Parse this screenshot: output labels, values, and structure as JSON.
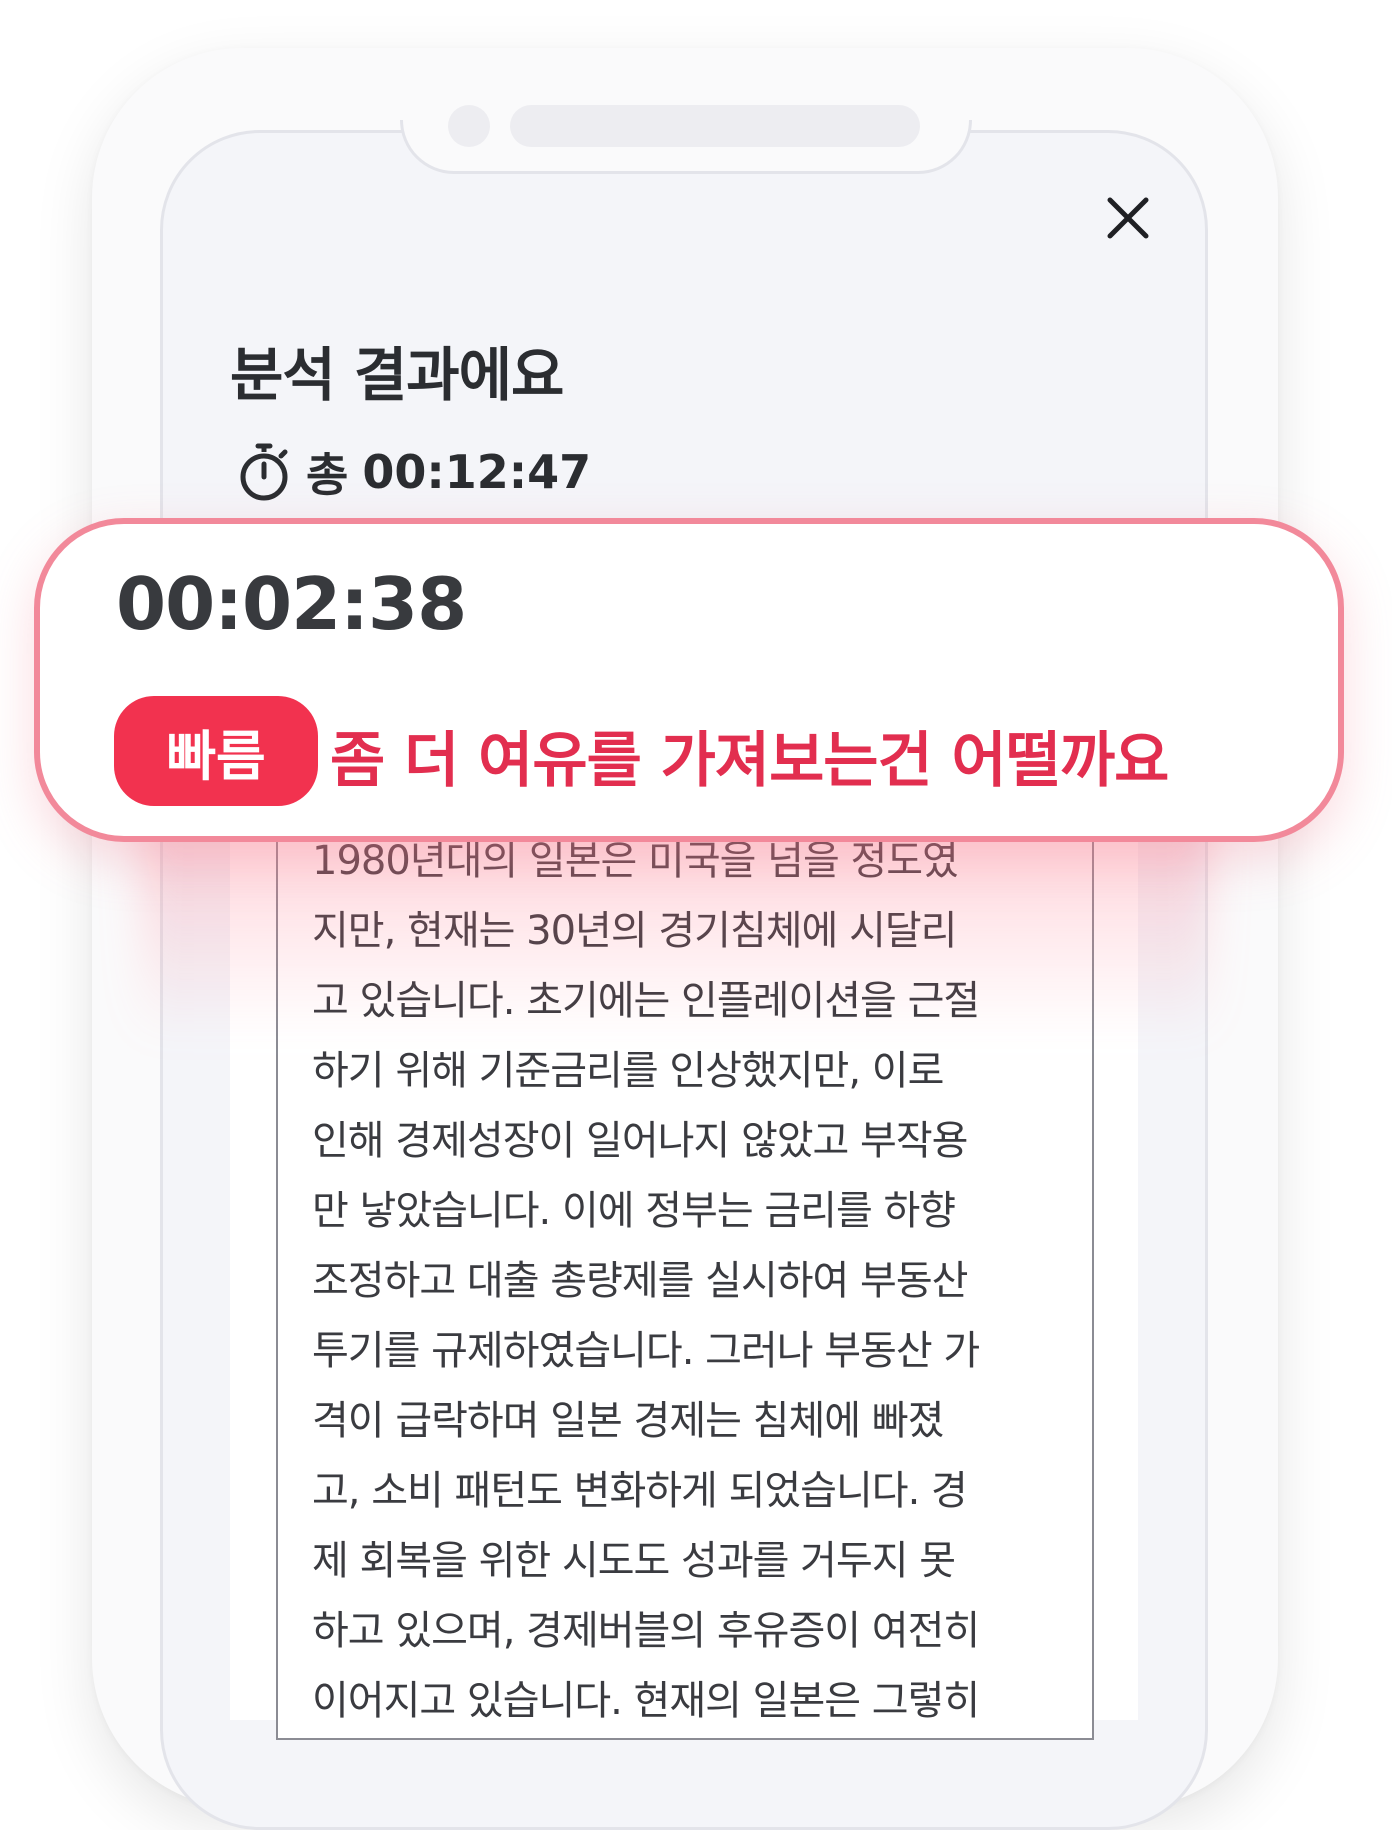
{
  "header": {
    "title": "분석 결과에요",
    "close_icon": "close-icon"
  },
  "total": {
    "icon": "stopwatch-icon",
    "prefix": "총",
    "time": "00:12:47"
  },
  "result": {
    "lap_time": "00:02:38",
    "badge": "빠름",
    "message": "좀 더 여유를 가져보는건 어떨까요"
  },
  "passage": {
    "text": "1980년대의 일본은 미국을 넘을 정도였\n지만, 현재는 30년의 경기침체에 시달리\n고 있습니다. 초기에는 인플레이션을 근절\n하기 위해 기준금리를 인상했지만, 이로\n인해 경제성장이 일어나지 않았고 부작용\n만 낳았습니다. 이에 정부는 금리를 하향\n조정하고 대출 총량제를 실시하여 부동산\n투기를 규제하였습니다. 그러나 부동산 가\n격이 급락하며 일본 경제는 침체에 빠졌\n고, 소비 패턴도 변화하게 되었습니다. 경\n제 회복을 위한 시도도 성과를 거두지 못\n하고 있으며, 경제버블의 후유증이 여전히\n이어지고 있습니다. 현재의 일본은 그렇히"
  },
  "colors": {
    "accent": "#f2324f",
    "advice_text": "#e22e4f",
    "card_border": "#f2899a",
    "screen_bg": "#f4f5f9",
    "title_text": "#2b2d31"
  }
}
